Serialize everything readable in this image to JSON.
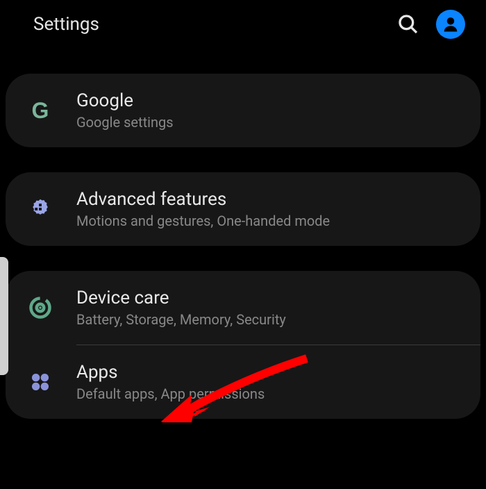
{
  "header": {
    "title": "Settings"
  },
  "items": {
    "google": {
      "title": "Google",
      "subtitle": "Google settings"
    },
    "advanced": {
      "title": "Advanced features",
      "subtitle": "Motions and gestures, One-handed mode"
    },
    "devicecare": {
      "title": "Device care",
      "subtitle": "Battery, Storage, Memory, Security"
    },
    "apps": {
      "title": "Apps",
      "subtitle": "Default apps, App permissions"
    }
  }
}
